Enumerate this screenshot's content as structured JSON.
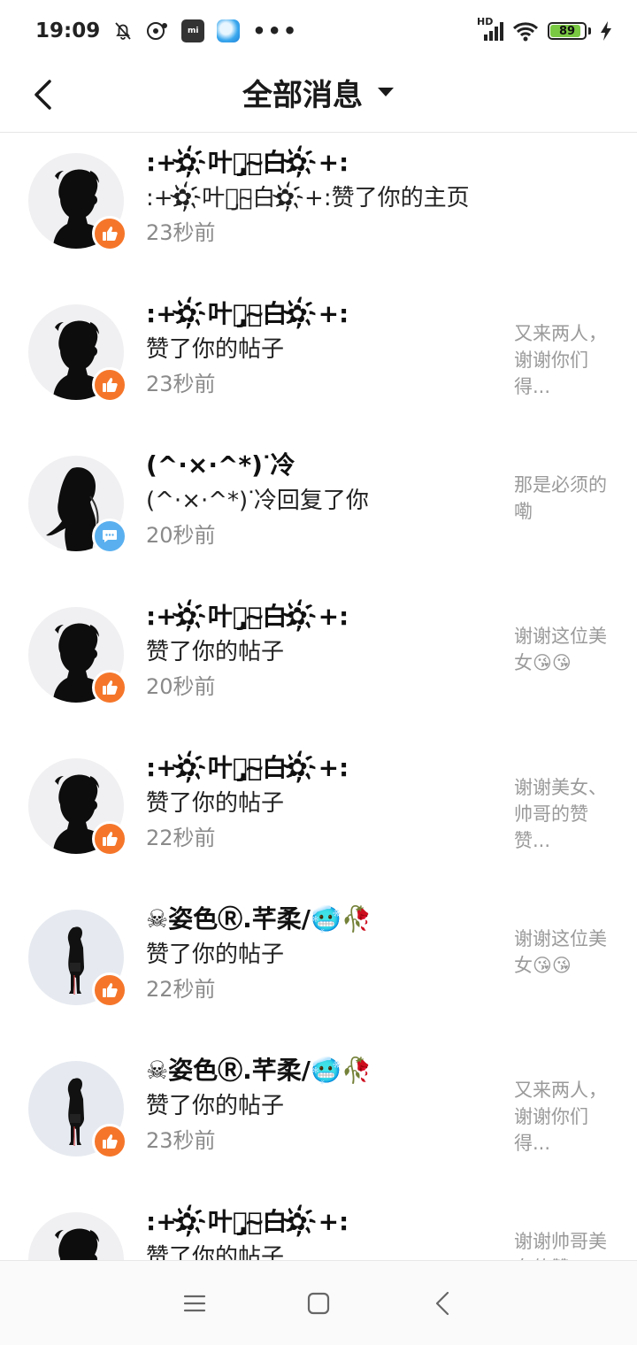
{
  "status_bar": {
    "time": "19:09",
    "mi_icon_text": "mi",
    "more_dots": "•••",
    "network_label": "HD",
    "battery_level": "89"
  },
  "header": {
    "title": "全部消息"
  },
  "notifications": [
    {
      "name": ":+✿҉叶ᅮ̡ᅮ̴白✿҉+:",
      "action": ":+✿҉叶ᅮ̡ᅮ̴白✿҉+:赞了你的主页",
      "time": "23秒前",
      "preview": "",
      "badge": "like",
      "avatar": "boy-silhouette"
    },
    {
      "name": ":+✿҉叶ᅮ̡ᅮ̴白✿҉+:",
      "action": "赞了你的帖子",
      "time": "23秒前",
      "preview": "又来两人，谢谢你们得...",
      "badge": "like",
      "avatar": "boy-silhouette"
    },
    {
      "name": "(^·×·^*)ᐝ冷",
      "action": "(^·×·^*)ᐝ冷回复了你",
      "time": "20秒前",
      "preview": "那是必须的嘞",
      "badge": "comment",
      "avatar": "girl-silhouette"
    },
    {
      "name": ":+✿҉叶ᅮ̡ᅮ̴白✿҉+:",
      "action": "赞了你的帖子",
      "time": "20秒前",
      "preview": "谢谢这位美女😘😘",
      "badge": "like",
      "avatar": "boy-silhouette"
    },
    {
      "name": ":+✿҉叶ᅮ̡ᅮ̴白✿҉+:",
      "action": "赞了你的帖子",
      "time": "22秒前",
      "preview": "谢谢美女、帅哥的赞赞...",
      "badge": "like",
      "avatar": "boy-silhouette"
    },
    {
      "name": "☠姿色Ⓡ.芊柔/🥶🥀",
      "action": "赞了你的帖子",
      "time": "22秒前",
      "preview": "谢谢这位美女😘😘",
      "badge": "like",
      "avatar": "girl-standing"
    },
    {
      "name": "☠姿色Ⓡ.芊柔/🥶🥀",
      "action": "赞了你的帖子",
      "time": "23秒前",
      "preview": "又来两人，谢谢你们得...",
      "badge": "like",
      "avatar": "girl-standing"
    },
    {
      "name": ":+✿҉叶ᅮ̡ᅮ̴白✿҉+:",
      "action": "赞了你的帖子",
      "time": "",
      "preview": "谢谢帅哥美女的赞",
      "badge": "like",
      "avatar": "boy-silhouette"
    }
  ],
  "colors": {
    "like_badge": "#f5762a",
    "comment_badge": "#5ab0ef",
    "battery_fill": "#7ac943"
  }
}
